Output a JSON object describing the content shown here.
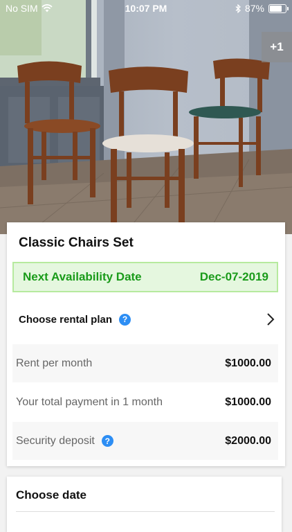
{
  "status_bar": {
    "carrier": "No SIM",
    "time": "10:07 PM",
    "battery_percent": "87%",
    "battery_level": 0.87
  },
  "gallery": {
    "more_count": "+1"
  },
  "product": {
    "title": "Classic Chairs Set",
    "availability": {
      "label": "Next Availability Date",
      "date": "Dec-07-2019"
    },
    "rental_plan": {
      "label": "Choose rental plan"
    },
    "rows": [
      {
        "label": "Rent per month",
        "value": "$1000.00"
      },
      {
        "label": "Your total payment in 1 month",
        "value": "$1000.00"
      },
      {
        "label": "Security deposit",
        "value": "$2000.00"
      }
    ]
  },
  "date_section": {
    "title": "Choose date"
  },
  "colors": {
    "accent_green": "#1a9b1a",
    "help_blue": "#2d8ef4"
  },
  "icons": [
    "wifi-icon",
    "bluetooth-icon",
    "battery-icon",
    "help-icon",
    "chevron-right-icon"
  ]
}
